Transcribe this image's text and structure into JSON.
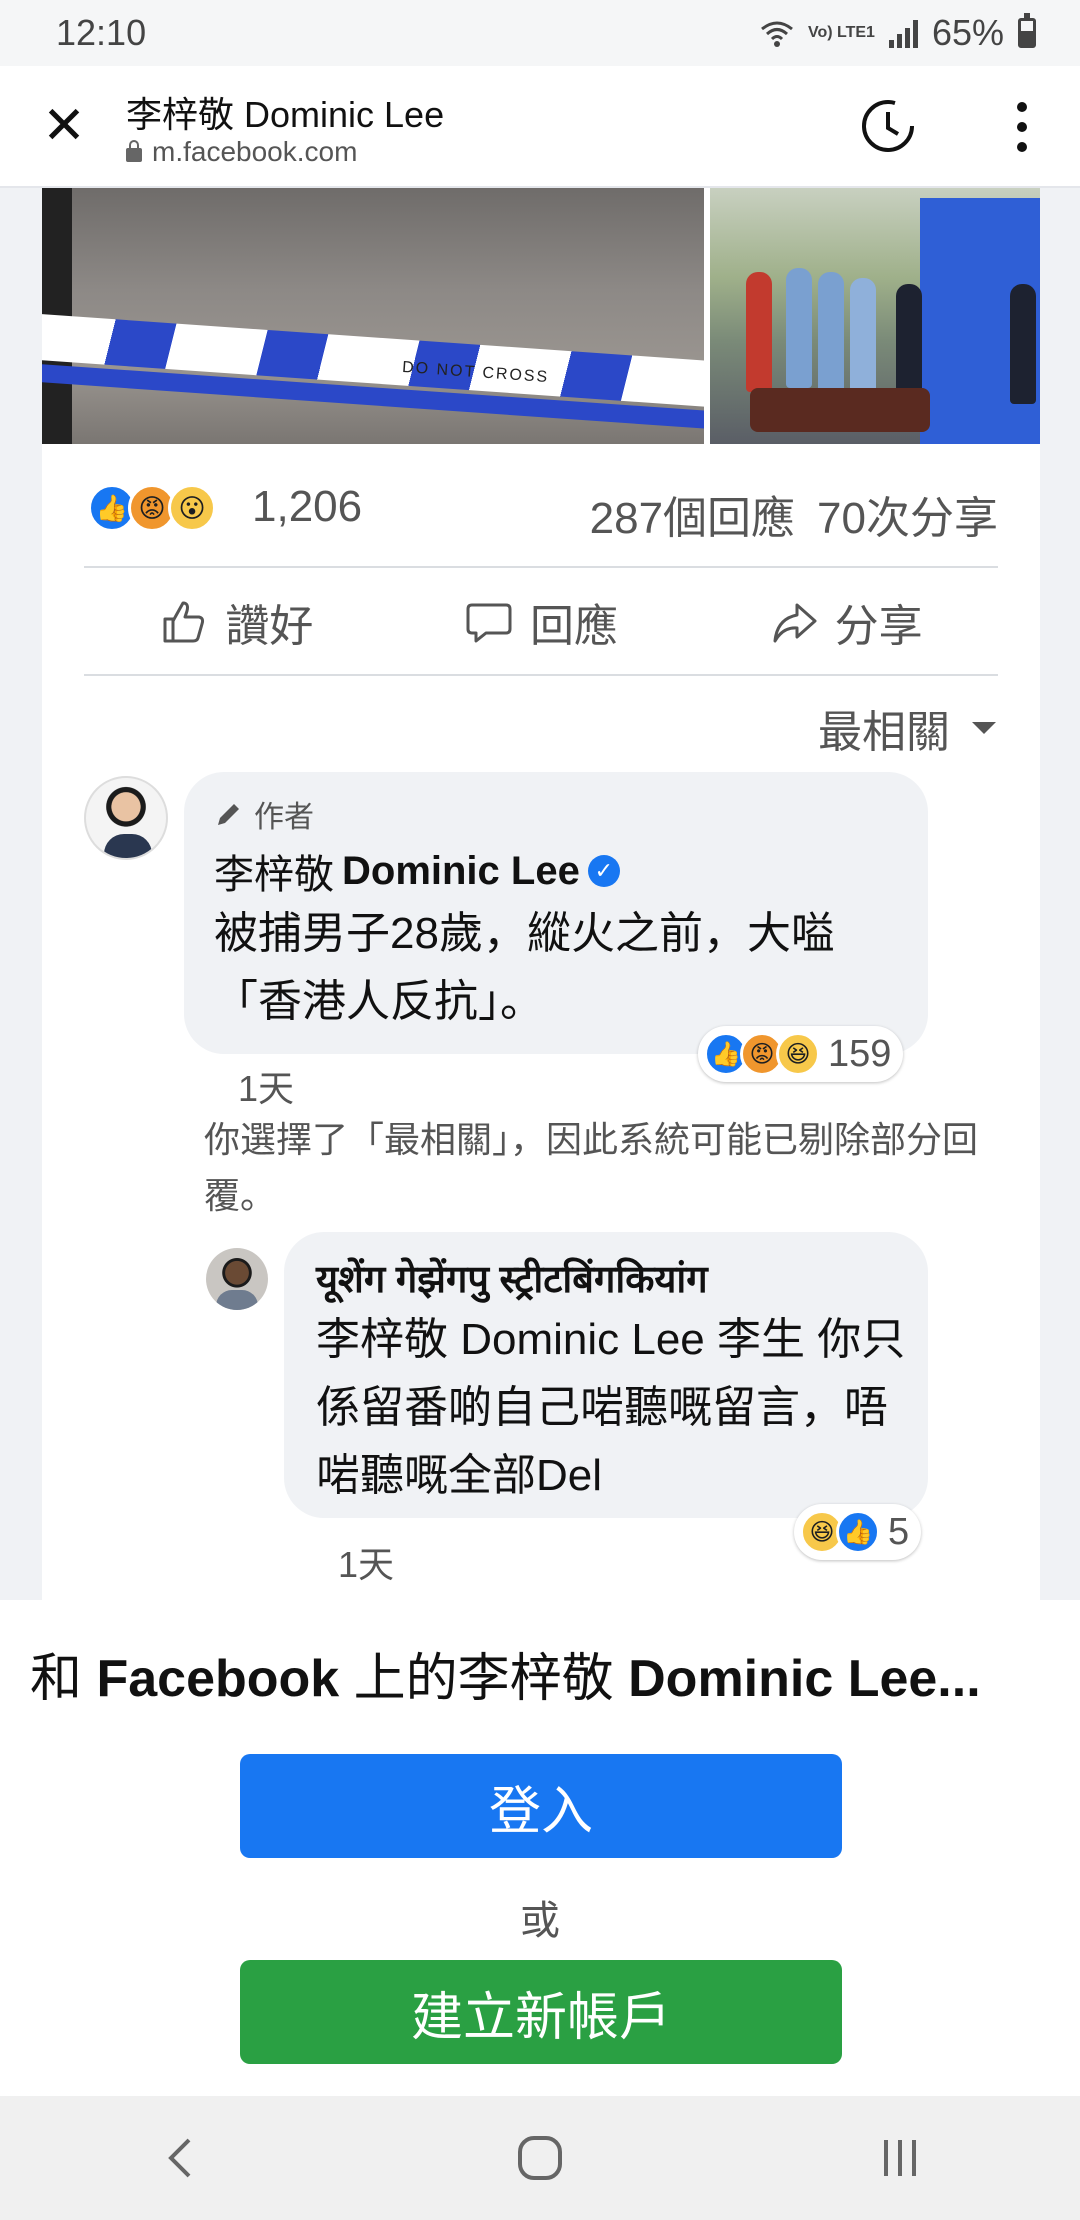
{
  "status": {
    "time": "12:10",
    "network": "Vo) LTE1",
    "battery": "65%"
  },
  "browser": {
    "title": "李梓敬 Dominic Lee",
    "url": "m.facebook.com"
  },
  "post": {
    "photo_tape_text": "DO NOT CROSS",
    "reactions_count": "1,206",
    "comments_count": "287個回應",
    "shares_count": "70次分享",
    "actions": {
      "like": "讚好",
      "comment": "回應",
      "share": "分享"
    },
    "sort_label": "最相關"
  },
  "comments": [
    {
      "author_tag": "作者",
      "name_cn": "李梓敬",
      "name_en": "Dominic Lee",
      "text": "被捕男子28歲，縱火之前，大嗌「香港人反抗」。",
      "reaction_count": "159",
      "time": "1天"
    },
    {
      "name": "यूशेंग गेझेंगपु स्ट्रीटबिंगकियांग",
      "text": "李梓敬 Dominic Lee 李生 你只係留番啲自己啱聽嘅留言，唔啱聽嘅全部Del",
      "reaction_count": "5",
      "time": "1天"
    }
  ],
  "notice": "你選擇了「最相關」，因此系統可能已剔除部分回覆。",
  "sheet": {
    "headline_prefix": "和",
    "headline_brand": "Facebook",
    "headline_mid": "上的李梓敬",
    "headline_name": "Dominic Lee...",
    "login": "登入",
    "or": "或",
    "create": "建立新帳戶"
  },
  "colors": {
    "facebook_blue": "#1877f2",
    "create_green": "#2aa043"
  }
}
